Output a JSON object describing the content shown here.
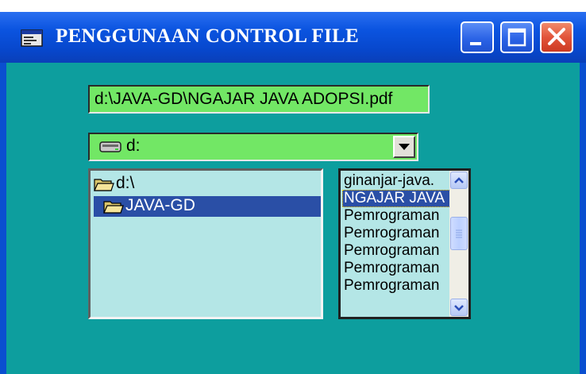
{
  "window": {
    "title": "PENGGUNAAN CONTROL FILE",
    "colors": {
      "titlebar": "#0b54e0",
      "client": "#0d9e9e",
      "field": "#72e765",
      "list": "#b4e6e6",
      "selection": "#2a4fa6"
    }
  },
  "path_field": {
    "value": "d:\\JAVA-GD\\NGAJAR JAVA ADOPSI.pdf"
  },
  "drive_list": {
    "selected": "d:",
    "icon": "drive-icon"
  },
  "dir_list": {
    "items": [
      {
        "label": "d:\\",
        "icon": "open-folder-icon",
        "selected": false
      },
      {
        "label": "JAVA-GD",
        "icon": "open-folder-icon",
        "selected": true
      }
    ]
  },
  "file_list": {
    "items": [
      "ginanjar-java.",
      "NGAJAR JAVA",
      "Pemrograman",
      "Pemrograman",
      "Pemrograman",
      "Pemrograman",
      "Pemrograman"
    ],
    "selected_index": 1
  },
  "caption_buttons": {
    "minimize": "minimize-icon",
    "maximize": "maximize-icon",
    "close": "close-icon"
  }
}
